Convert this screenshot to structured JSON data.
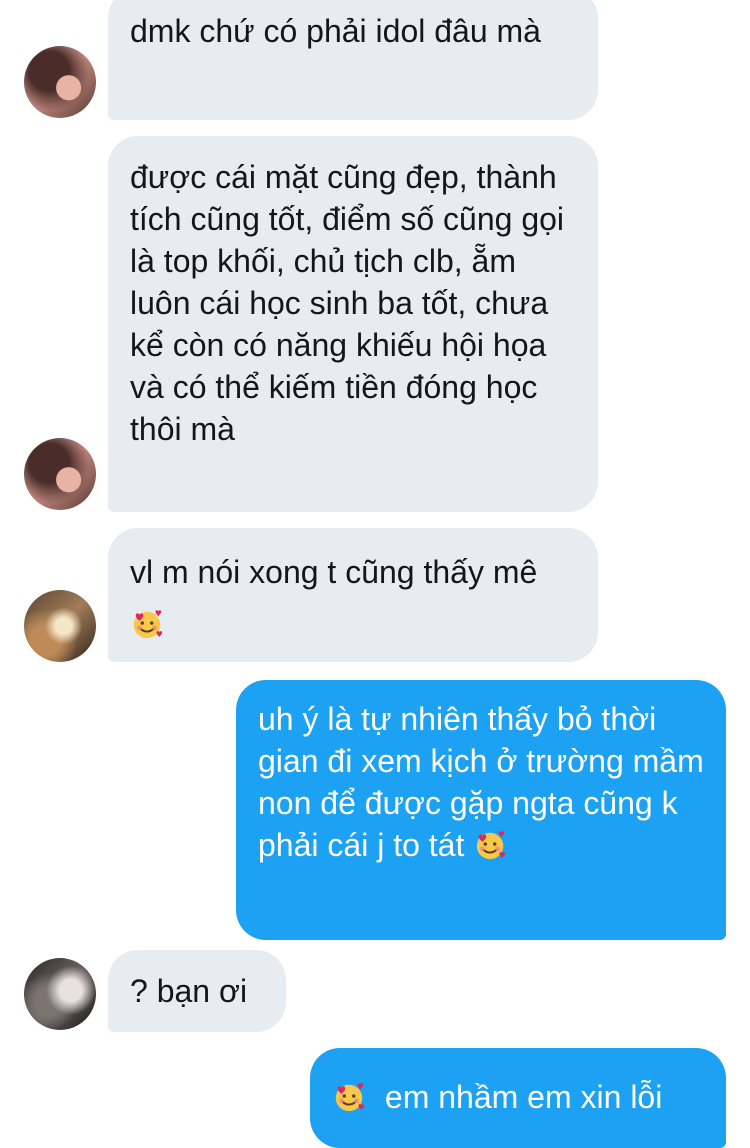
{
  "messages": [
    {
      "text": "dmk chứ có phải idol đâu mà"
    },
    {
      "text": "được cái mặt cũng đẹp, thành tích cũng tốt, điểm số cũng gọi là top khối, chủ tịch clb, ẵm luôn cái học sinh ba tốt, chưa kể còn có năng khiếu hội họa và có thể kiếm tiền đóng học thôi mà"
    },
    {
      "text": "vl m nói xong t cũng thấy mê"
    },
    {
      "text": "uh ý là tự nhiên thấy bỏ thời gian đi xem kịch ở trường mầm non để được gặp ngta cũng k phải cái j to tát"
    },
    {
      "text": "? bạn ơi"
    },
    {
      "text": "em nhầm em xin lỗi"
    }
  ],
  "icons": {
    "emoji": "smiling-face-with-hearts-icon",
    "avatar_1": "avatar",
    "avatar_2": "avatar",
    "avatar_3": "avatar"
  },
  "colors": {
    "incoming_bubble": "#e6ecf0",
    "outgoing_bubble": "#1da1f2",
    "incoming_text": "#14171a",
    "outgoing_text": "#ffffff"
  }
}
